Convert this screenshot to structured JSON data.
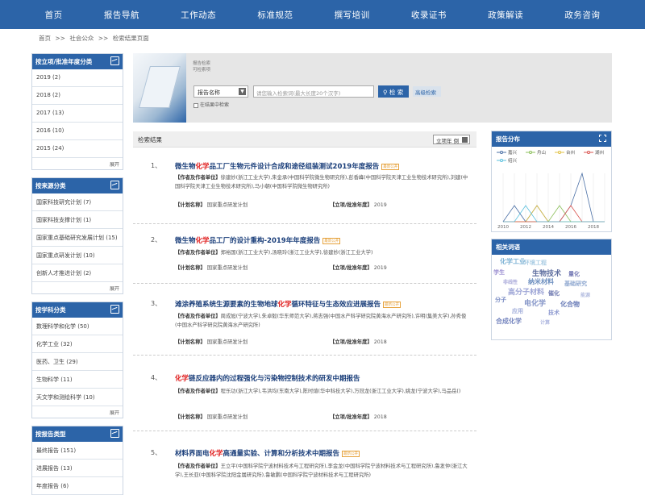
{
  "nav": [
    "首页",
    "报告导航",
    "工作动态",
    "标准规范",
    "撰写培训",
    "收录证书",
    "政策解读",
    "政务咨询"
  ],
  "breadcrumb": [
    "首页",
    ">>",
    "社会公众",
    ">>",
    "检索结果页面"
  ],
  "left": [
    {
      "title": "按立项/批准年度分类",
      "items": [
        "2019 (2)",
        "2018 (2)",
        "2017 (13)",
        "2016 (10)",
        "2015 (24)"
      ],
      "more": "展开"
    },
    {
      "title": "按来源分类",
      "items": [
        "国家科技研究计划 (7)",
        "国家科技支撑计划 (1)",
        "国家重点基础研究发展计划 (15)",
        "国家重点研发计划 (10)",
        "创新人才推进计划 (2)"
      ],
      "more": "展开"
    },
    {
      "title": "按学科分类",
      "items": [
        "数理科学和化学 (50)",
        "化学工业 (32)",
        "医药、卫生 (29)",
        "生物科学 (11)",
        "天文学和测绘科学 (10)"
      ],
      "more": "展开"
    },
    {
      "title": "按报告类型",
      "items": [
        "最终报告 (151)",
        "进展报告 (13)",
        "年度报告 (6)"
      ],
      "more": ""
    }
  ],
  "search": {
    "history": [
      "报告检索",
      "可检索项"
    ],
    "field": "报告名称",
    "placeholder": "请您输入检索词(最大长度20个汉字)",
    "button": "检 索",
    "advanced": "高级检索",
    "within": "在结果中检索"
  },
  "results": {
    "label": "检索结果",
    "sort": "立项年 倒",
    "items": [
      {
        "no": "1、",
        "pre": "微生物",
        "hl": "化学",
        "post": "品工厂生物元件设计合成和途径组装测试2019年度报告",
        "badge": "最新公开",
        "authors_label": "【作者及作者单位】",
        "authors": "徐建妙(浙江工业大学),朱金承(中国科学院微生物研究所),彭香峰(中国科学院天津工业生物技术研究所),刘建(中国科学院天津工业生物技术研究所),马小朝(中国科学院微生物研究所)",
        "plan_label": "【计划名称】",
        "plan": "国家重点研发计划",
        "year_label": "【立项/批准年度】",
        "year": "2019"
      },
      {
        "no": "2、",
        "pre": "微生物",
        "hl": "化学",
        "post": "品工厂的设计重构-2019年年度报告",
        "badge": "最新公开",
        "authors_label": "【作者及作者单位】",
        "authors": "郑裕国(浙江工业大学),汤晓玲(浙江工业大学),徐建妙(浙江工业大学)",
        "plan_label": "【计划名称】",
        "plan": "国家重点研发计划",
        "year_label": "【立项/批准年度】",
        "year": "2019"
      },
      {
        "no": "3、",
        "pre": "滩涂养殖系统生源要素的生物地球",
        "hl": "化学",
        "post": "循环特征与生态效应进展报告",
        "badge": "最新公开",
        "authors_label": "【作者及作者单位】",
        "authors": "周成旭(宁波大学),朱卓毅(华东师范大学),蒋志强(中国水产科学研究院黄海水产研究所),许明(集美大学),孙秀俊(中国水产科学研究院黄海水产研究所)",
        "plan_label": "【计划名称】",
        "plan": "国家重点研发计划",
        "year_label": "【立项/批准年度】",
        "year": "2018"
      },
      {
        "no": "4、",
        "pre": "",
        "hl": "化学",
        "post": "链反应器内的过程强化与污染物控制技术的研发中期报告",
        "badge": "",
        "authors_label": "【作者及作者单位】",
        "authors": "程乐功(浙江大学),韦洪均(东南大学),陈时煊(华中科技大学),万冠龙(浙江工业大学),姚龙(宁波大学),马品岳()",
        "plan_label": "【计划名称】",
        "plan": "国家重点研发计划",
        "year_label": "【立项/批准年度】",
        "year": "2018"
      },
      {
        "no": "5、",
        "pre": "材料界面电",
        "hl": "化学",
        "post": "高通量实验、计算和分析技术中期报告",
        "badge": "最新公开",
        "authors_label": "【作者及作者单位】",
        "authors": "王立平(中国科学院宁波材料技术与工程研究所),李金龙(中国科学院宁波材料技术与工程研究所),鲁发仲(浙江大学),王长亚(中国科学院沈阳金属研究所),鲁敏鹏(中国科学院宁波材料技术与工程研究所)",
        "plan_label": "",
        "plan": "",
        "year_label": "",
        "year": ""
      }
    ]
  },
  "right": {
    "chart_title": "报告分布",
    "wordcloud_title": "相关词语"
  },
  "chart_data": {
    "type": "line",
    "title": "报告分布",
    "x": [
      2010,
      2011,
      2012,
      2013,
      2014,
      2015,
      2016,
      2017,
      2018,
      2019
    ],
    "xticks": [
      "2010",
      "2012",
      "2014",
      "2016",
      "2018"
    ],
    "series": [
      {
        "name": "嘉兴",
        "color": "#4a6fa5",
        "values": [
          0,
          1,
          0,
          1,
          0,
          0,
          1,
          3,
          0,
          0
        ]
      },
      {
        "name": "舟山",
        "color": "#8bbf5a",
        "values": [
          0,
          0,
          0,
          0,
          0,
          1,
          0,
          0,
          0,
          0
        ]
      },
      {
        "name": "台州",
        "color": "#e0c040",
        "values": [
          0,
          0,
          0,
          1,
          0,
          0,
          0,
          0,
          0,
          0
        ]
      },
      {
        "name": "湖州",
        "color": "#d9534f",
        "values": [
          0,
          0,
          0,
          0,
          0,
          0,
          1,
          0,
          0,
          0
        ]
      },
      {
        "name": "绍兴",
        "color": "#5bc0de",
        "values": [
          0,
          0,
          1,
          0,
          0,
          0,
          0,
          0,
          0,
          0
        ]
      }
    ],
    "legend": "top"
  },
  "wordcloud": [
    {
      "text": "化学工业",
      "color": "#7fb3d5"
    },
    {
      "text": "环境工程",
      "color": "#a9cce3"
    },
    {
      "text": "学生",
      "color": "#9b8fd1"
    },
    {
      "text": "生物技术",
      "color": "#5d6d9e"
    },
    {
      "text": "量化",
      "color": "#7b7fb8"
    },
    {
      "text": "非线性",
      "color": "#a9a9d9"
    },
    {
      "text": "纳米材料",
      "color": "#6c8ebf"
    },
    {
      "text": "基础研究",
      "color": "#8fa8d0"
    },
    {
      "text": "高分子材料",
      "color": "#9da5d6"
    },
    {
      "text": "催化",
      "color": "#6f79b0"
    },
    {
      "text": "能源",
      "color": "#b4bde0"
    },
    {
      "text": "分子",
      "color": "#7a8cc4"
    },
    {
      "text": "电化学",
      "color": "#8797c9"
    },
    {
      "text": "化合物",
      "color": "#6b7db8"
    },
    {
      "text": "应用",
      "color": "#a4b0dc"
    },
    {
      "text": "技术",
      "color": "#8e9ad0"
    },
    {
      "text": "合成化学",
      "color": "#7686bf"
    },
    {
      "text": "计算",
      "color": "#b0b8e0"
    }
  ]
}
